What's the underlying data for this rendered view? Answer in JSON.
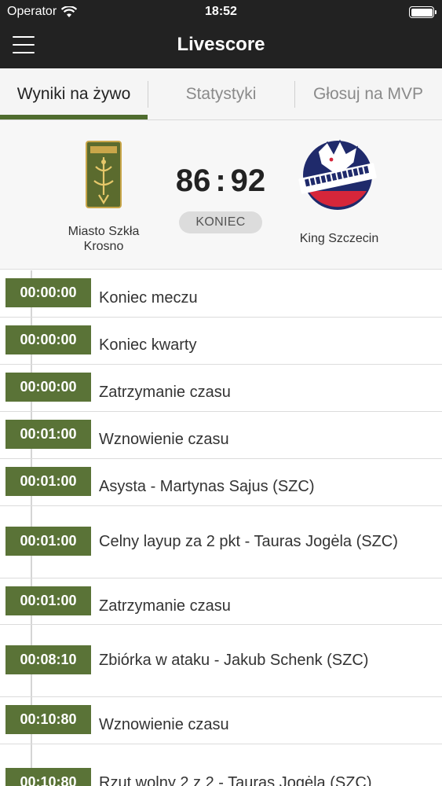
{
  "status_bar": {
    "carrier": "Operator",
    "time": "18:52",
    "icons": [
      "wifi-icon",
      "battery-icon"
    ]
  },
  "nav": {
    "title": "Livescore",
    "menu_icon": "hamburger-menu-icon"
  },
  "tabs": [
    {
      "label": "Wyniki na żywo",
      "active": true
    },
    {
      "label": "Statystyki",
      "active": false
    },
    {
      "label": "Głosuj na MVP",
      "active": false
    }
  ],
  "colors": {
    "accent": "#4f6c2e",
    "time_badge": "#5a7337",
    "header": "#222222"
  },
  "match": {
    "home": {
      "name": "Miasto Szkła Krosno",
      "logo": "krosno-crest-logo"
    },
    "away": {
      "name": "King Szczecin",
      "logo": "wilki-morskie-wolf-logo"
    },
    "home_score": "86",
    "away_score": "92",
    "score_separator": ":",
    "status": "KONIEC"
  },
  "events": [
    {
      "time": "00:00:00",
      "text": "Koniec meczu"
    },
    {
      "time": "00:00:00",
      "text": "Koniec kwarty"
    },
    {
      "time": "00:00:00",
      "text": "Zatrzymanie czasu"
    },
    {
      "time": "00:01:00",
      "text": "Wznowienie czasu"
    },
    {
      "time": "00:01:00",
      "text": "Asysta - Martynas Sajus (SZC)"
    },
    {
      "time": "00:01:00",
      "text": "Celny layup za 2 pkt - Tauras Jogėla (SZC)"
    },
    {
      "time": "00:01:00",
      "text": "Zatrzymanie czasu"
    },
    {
      "time": "00:08:10",
      "text": "Zbiórka w ataku - Jakub Schenk (SZC)"
    },
    {
      "time": "00:10:80",
      "text": "Wznowienie czasu"
    },
    {
      "time": "00:10:80",
      "text": "Rzut wolny 2 z 2 - Tauras Jogėla (SZC)"
    }
  ]
}
